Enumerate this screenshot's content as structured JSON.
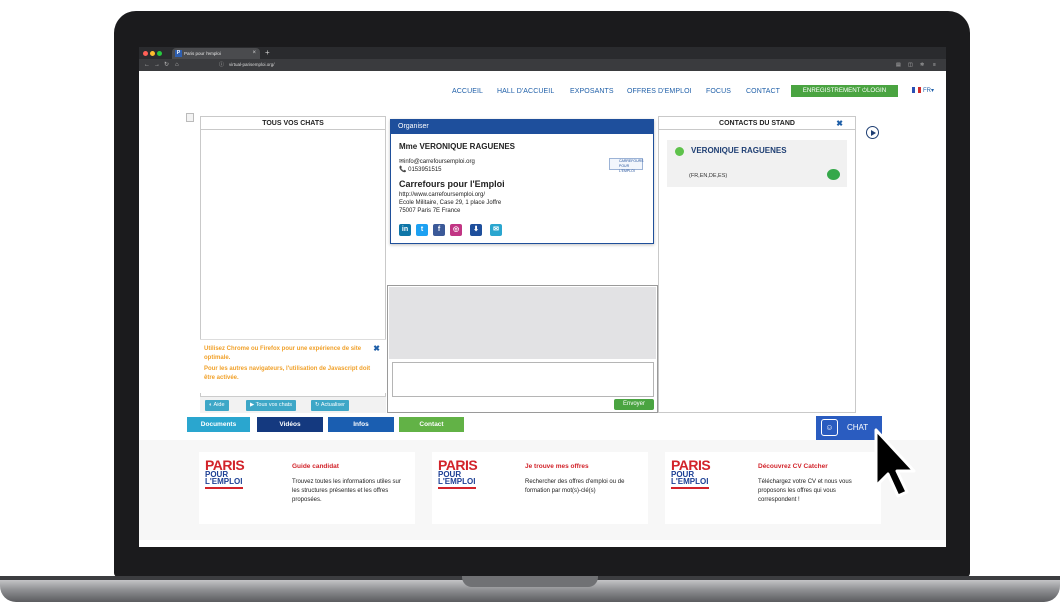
{
  "browser": {
    "tab_title": "Paris pour l'emploi",
    "tab_favicon": "P",
    "new_tab": "+",
    "url": "virtual-parisemploi.org/"
  },
  "nav": {
    "links": [
      "ACCUEIL",
      "HALL D'ACCUEIL",
      "EXPOSANTS",
      "OFFRES D'EMPLOI",
      "FOCUS",
      "CONTACT"
    ],
    "register_login": "ENREGISTREMENT ⏻LOGIN",
    "language": "FR▾"
  },
  "chat": {
    "left_header": "TOUS VOS CHATS",
    "warning": {
      "line1": "Utilisez Chrome ou Firefox pour une expérience de site optimale.",
      "line2": "Pour les autres navigateurs, l'utilisation de Javascript doit être activée.",
      "close": "✖"
    },
    "buttons": {
      "help": "Aide",
      "all_chats": "Tous vos chats",
      "refresh": "Actualiser"
    },
    "send": "Envoyer",
    "right_header": "CONTACTS DU STAND",
    "right_close": "✖",
    "contact": {
      "name": "VERONIQUE RAGUENES",
      "languages": "(FR,EN,DE,ES)"
    }
  },
  "organiser": {
    "header": "Organiser",
    "name": "Mme VERONIQUE RAGUENES",
    "email": "✉info@carrefoursemploi.org",
    "phone": "📞 0153951515",
    "company": "Carrefours pour l'Emploi",
    "website": "http://www.carrefoursemploi.org/",
    "address1": "Ecole Militaire, Case 29, 1 place Joffre",
    "address2": "75007 Paris 7E France",
    "logo_text": "CARREFOURS POUR L'EMPLOI"
  },
  "tabs": [
    {
      "label": "Documents",
      "color": "#2aa6cf"
    },
    {
      "label": "Vidéos",
      "color": "#14397f"
    },
    {
      "label": "Infos",
      "color": "#1a5eb1"
    },
    {
      "label": "Contact",
      "color": "#62b246"
    }
  ],
  "chat_button": "CHAT",
  "cards": [
    {
      "logo": [
        "PARIS",
        "POUR",
        "L'EMPLOI"
      ],
      "title": "Guide candidat",
      "text": "Trouvez toutes les informations utiles sur les structures présentes et les offres proposées."
    },
    {
      "logo": [
        "PARIS",
        "POUR",
        "L'EMPLOI"
      ],
      "title": "Je trouve mes offres",
      "text": "Rechercher des offres d'emploi ou de formation par mot(s)-clé(s)"
    },
    {
      "logo": [
        "PARIS",
        "POUR",
        "L'EMPLOI"
      ],
      "title": "Découvrez CV Catcher",
      "text": "Téléchargez votre CV et nous vous proposons les offres qui vous correspondent !"
    }
  ],
  "colors": {
    "accent_blue": "#1e4f9c",
    "green": "#4aa441",
    "brand_red": "#d2232a"
  }
}
